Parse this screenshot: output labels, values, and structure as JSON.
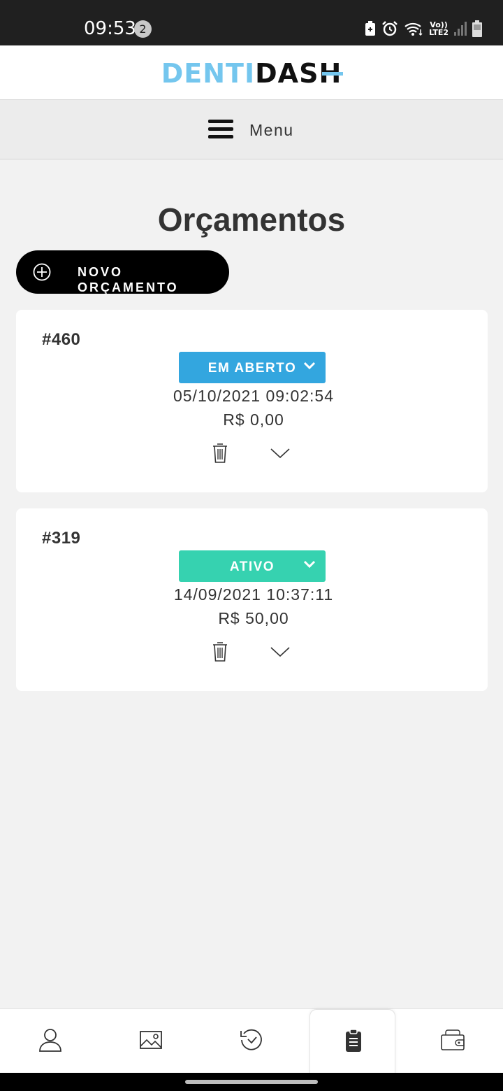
{
  "status_bar": {
    "time": "09:53",
    "notification_count": "2",
    "network_top": "Vo))",
    "network_bottom": "LTE2"
  },
  "header": {
    "logo_part1": "DENTI",
    "logo_part2": "DASH",
    "logo_colors": {
      "accent": "#74c6ee",
      "dark": "#111111"
    }
  },
  "menu": {
    "label": "Menu"
  },
  "page": {
    "title": "Orçamentos",
    "new_button_label": "NOVO ORÇAMENTO"
  },
  "budgets": [
    {
      "id": "#460",
      "status": "EM ABERTO",
      "status_color": "#33a6df",
      "datetime": "05/10/2021 09:02:54",
      "value": "R$ 0,00"
    },
    {
      "id": "#319",
      "status": "ATIVO",
      "status_color": "#36d2b0",
      "datetime": "14/09/2021 10:37:11",
      "value": "R$ 50,00"
    }
  ],
  "bottom_nav": {
    "items": [
      {
        "icon": "user-icon",
        "active": false
      },
      {
        "icon": "image-icon",
        "active": false
      },
      {
        "icon": "history-icon",
        "active": false
      },
      {
        "icon": "clipboard-icon",
        "active": true
      },
      {
        "icon": "wallet-icon",
        "active": false
      }
    ]
  }
}
